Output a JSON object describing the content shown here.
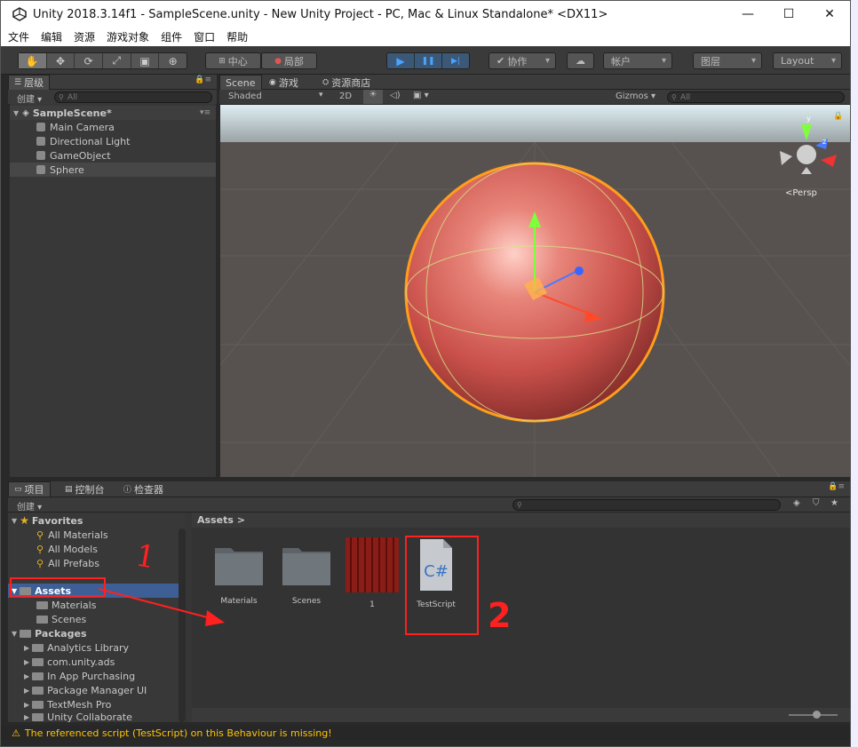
{
  "title_bar": {
    "title": "Unity 2018.3.14f1 - SampleScene.unity - New Unity Project - PC, Mac & Linux Standalone* <DX11>",
    "minimize": "—",
    "maximize": "☐",
    "close": "✕"
  },
  "menu": [
    "文件",
    "编辑",
    "资源",
    "游戏对象",
    "组件",
    "窗口",
    "帮助"
  ],
  "toolbar": {
    "tools": [
      "✋",
      "✥",
      "⟳",
      "⤢",
      "▣",
      "⊕"
    ],
    "pivot": "中心",
    "space": "局部",
    "play": "▶",
    "pause": "❚❚",
    "step": "▶|",
    "collab": "协作",
    "cloud": "☁",
    "account": "帐户",
    "layers": "图层",
    "layout": "Layout"
  },
  "hierarchy": {
    "tab": "层级",
    "create": "创建 ▾",
    "search_placeholder": "All",
    "scene": "SampleScene*",
    "items": [
      "Main Camera",
      "Directional Light",
      "GameObject",
      "Sphere"
    ]
  },
  "scene_view": {
    "tabs": [
      "Scene",
      "游戏",
      "资源商店"
    ],
    "shading": "Shaded",
    "mode_2d": "2D",
    "gizmos": "Gizmos ▾",
    "search_placeholder": "All",
    "persp": "<Persp"
  },
  "bottom_tabs": [
    "项目",
    "控制台",
    "检查器"
  ],
  "project": {
    "create": "创建 ▾",
    "favorites": "Favorites",
    "favorite_items": [
      "All Materials",
      "All Models",
      "All Prefabs"
    ],
    "assets": "Assets",
    "asset_children": [
      "Materials",
      "Scenes"
    ],
    "packages": "Packages",
    "package_items": [
      "Analytics Library",
      "com.unity.ads",
      "In App Purchasing",
      "Package Manager UI",
      "TextMesh Pro",
      "Unity Collaborate"
    ],
    "breadcrumb": "Assets >",
    "grid_items": [
      {
        "label": "Materials",
        "type": "folder"
      },
      {
        "label": "Scenes",
        "type": "folder"
      },
      {
        "label": "1",
        "type": "material"
      },
      {
        "label": "TestScript",
        "type": "script",
        "glyph": "C#"
      }
    ]
  },
  "annotations": {
    "label1": "1",
    "label2": "2",
    "color": "#ff2020"
  },
  "status": {
    "message": "The referenced script (TestScript) on this Behaviour is missing!",
    "icon": "⚠"
  },
  "colors": {
    "play_blue": "#4aa3ff",
    "selection": "#3e5f96",
    "warning": "#ffc500"
  }
}
